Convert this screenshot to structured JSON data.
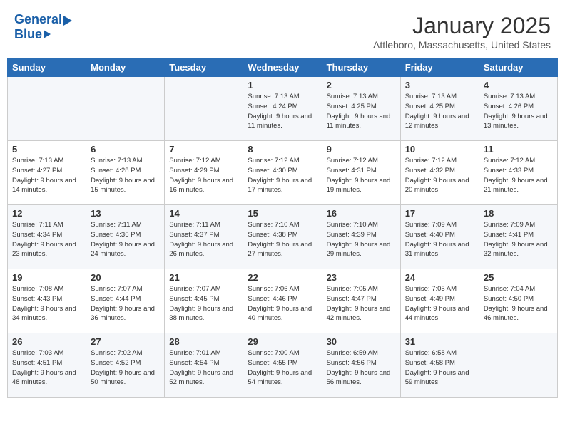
{
  "header": {
    "logo_general": "General",
    "logo_blue": "Blue",
    "month": "January 2025",
    "location": "Attleboro, Massachusetts, United States"
  },
  "weekdays": [
    "Sunday",
    "Monday",
    "Tuesday",
    "Wednesday",
    "Thursday",
    "Friday",
    "Saturday"
  ],
  "weeks": [
    [
      {
        "day": "",
        "sunrise": "",
        "sunset": "",
        "daylight": ""
      },
      {
        "day": "",
        "sunrise": "",
        "sunset": "",
        "daylight": ""
      },
      {
        "day": "",
        "sunrise": "",
        "sunset": "",
        "daylight": ""
      },
      {
        "day": "1",
        "sunrise": "Sunrise: 7:13 AM",
        "sunset": "Sunset: 4:24 PM",
        "daylight": "Daylight: 9 hours and 11 minutes."
      },
      {
        "day": "2",
        "sunrise": "Sunrise: 7:13 AM",
        "sunset": "Sunset: 4:25 PM",
        "daylight": "Daylight: 9 hours and 11 minutes."
      },
      {
        "day": "3",
        "sunrise": "Sunrise: 7:13 AM",
        "sunset": "Sunset: 4:25 PM",
        "daylight": "Daylight: 9 hours and 12 minutes."
      },
      {
        "day": "4",
        "sunrise": "Sunrise: 7:13 AM",
        "sunset": "Sunset: 4:26 PM",
        "daylight": "Daylight: 9 hours and 13 minutes."
      }
    ],
    [
      {
        "day": "5",
        "sunrise": "Sunrise: 7:13 AM",
        "sunset": "Sunset: 4:27 PM",
        "daylight": "Daylight: 9 hours and 14 minutes."
      },
      {
        "day": "6",
        "sunrise": "Sunrise: 7:13 AM",
        "sunset": "Sunset: 4:28 PM",
        "daylight": "Daylight: 9 hours and 15 minutes."
      },
      {
        "day": "7",
        "sunrise": "Sunrise: 7:12 AM",
        "sunset": "Sunset: 4:29 PM",
        "daylight": "Daylight: 9 hours and 16 minutes."
      },
      {
        "day": "8",
        "sunrise": "Sunrise: 7:12 AM",
        "sunset": "Sunset: 4:30 PM",
        "daylight": "Daylight: 9 hours and 17 minutes."
      },
      {
        "day": "9",
        "sunrise": "Sunrise: 7:12 AM",
        "sunset": "Sunset: 4:31 PM",
        "daylight": "Daylight: 9 hours and 19 minutes."
      },
      {
        "day": "10",
        "sunrise": "Sunrise: 7:12 AM",
        "sunset": "Sunset: 4:32 PM",
        "daylight": "Daylight: 9 hours and 20 minutes."
      },
      {
        "day": "11",
        "sunrise": "Sunrise: 7:12 AM",
        "sunset": "Sunset: 4:33 PM",
        "daylight": "Daylight: 9 hours and 21 minutes."
      }
    ],
    [
      {
        "day": "12",
        "sunrise": "Sunrise: 7:11 AM",
        "sunset": "Sunset: 4:34 PM",
        "daylight": "Daylight: 9 hours and 23 minutes."
      },
      {
        "day": "13",
        "sunrise": "Sunrise: 7:11 AM",
        "sunset": "Sunset: 4:36 PM",
        "daylight": "Daylight: 9 hours and 24 minutes."
      },
      {
        "day": "14",
        "sunrise": "Sunrise: 7:11 AM",
        "sunset": "Sunset: 4:37 PM",
        "daylight": "Daylight: 9 hours and 26 minutes."
      },
      {
        "day": "15",
        "sunrise": "Sunrise: 7:10 AM",
        "sunset": "Sunset: 4:38 PM",
        "daylight": "Daylight: 9 hours and 27 minutes."
      },
      {
        "day": "16",
        "sunrise": "Sunrise: 7:10 AM",
        "sunset": "Sunset: 4:39 PM",
        "daylight": "Daylight: 9 hours and 29 minutes."
      },
      {
        "day": "17",
        "sunrise": "Sunrise: 7:09 AM",
        "sunset": "Sunset: 4:40 PM",
        "daylight": "Daylight: 9 hours and 31 minutes."
      },
      {
        "day": "18",
        "sunrise": "Sunrise: 7:09 AM",
        "sunset": "Sunset: 4:41 PM",
        "daylight": "Daylight: 9 hours and 32 minutes."
      }
    ],
    [
      {
        "day": "19",
        "sunrise": "Sunrise: 7:08 AM",
        "sunset": "Sunset: 4:43 PM",
        "daylight": "Daylight: 9 hours and 34 minutes."
      },
      {
        "day": "20",
        "sunrise": "Sunrise: 7:07 AM",
        "sunset": "Sunset: 4:44 PM",
        "daylight": "Daylight: 9 hours and 36 minutes."
      },
      {
        "day": "21",
        "sunrise": "Sunrise: 7:07 AM",
        "sunset": "Sunset: 4:45 PM",
        "daylight": "Daylight: 9 hours and 38 minutes."
      },
      {
        "day": "22",
        "sunrise": "Sunrise: 7:06 AM",
        "sunset": "Sunset: 4:46 PM",
        "daylight": "Daylight: 9 hours and 40 minutes."
      },
      {
        "day": "23",
        "sunrise": "Sunrise: 7:05 AM",
        "sunset": "Sunset: 4:47 PM",
        "daylight": "Daylight: 9 hours and 42 minutes."
      },
      {
        "day": "24",
        "sunrise": "Sunrise: 7:05 AM",
        "sunset": "Sunset: 4:49 PM",
        "daylight": "Daylight: 9 hours and 44 minutes."
      },
      {
        "day": "25",
        "sunrise": "Sunrise: 7:04 AM",
        "sunset": "Sunset: 4:50 PM",
        "daylight": "Daylight: 9 hours and 46 minutes."
      }
    ],
    [
      {
        "day": "26",
        "sunrise": "Sunrise: 7:03 AM",
        "sunset": "Sunset: 4:51 PM",
        "daylight": "Daylight: 9 hours and 48 minutes."
      },
      {
        "day": "27",
        "sunrise": "Sunrise: 7:02 AM",
        "sunset": "Sunset: 4:52 PM",
        "daylight": "Daylight: 9 hours and 50 minutes."
      },
      {
        "day": "28",
        "sunrise": "Sunrise: 7:01 AM",
        "sunset": "Sunset: 4:54 PM",
        "daylight": "Daylight: 9 hours and 52 minutes."
      },
      {
        "day": "29",
        "sunrise": "Sunrise: 7:00 AM",
        "sunset": "Sunset: 4:55 PM",
        "daylight": "Daylight: 9 hours and 54 minutes."
      },
      {
        "day": "30",
        "sunrise": "Sunrise: 6:59 AM",
        "sunset": "Sunset: 4:56 PM",
        "daylight": "Daylight: 9 hours and 56 minutes."
      },
      {
        "day": "31",
        "sunrise": "Sunrise: 6:58 AM",
        "sunset": "Sunset: 4:58 PM",
        "daylight": "Daylight: 9 hours and 59 minutes."
      },
      {
        "day": "",
        "sunrise": "",
        "sunset": "",
        "daylight": ""
      }
    ]
  ]
}
